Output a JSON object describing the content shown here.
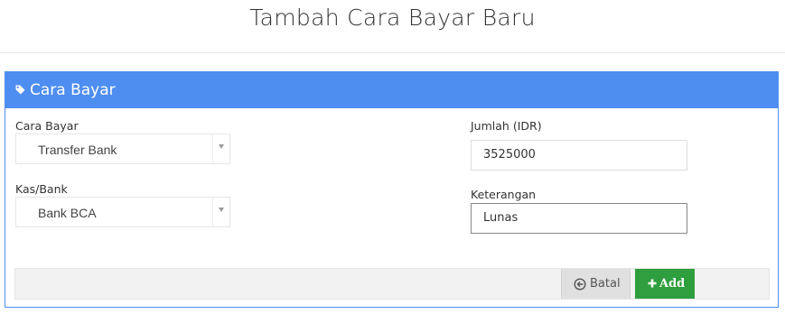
{
  "page": {
    "title": "Tambah Cara Bayar Baru"
  },
  "panel": {
    "heading": "Cara Bayar",
    "icon": "tag-icon",
    "accent_color": "#4f8ef1"
  },
  "form": {
    "cara_bayar": {
      "label": "Cara Bayar",
      "value": "Transfer Bank"
    },
    "kas_bank": {
      "label": "Kas/Bank",
      "value": "Bank BCA"
    },
    "jumlah": {
      "label": "Jumlah (IDR)",
      "value": "3525000"
    },
    "keterangan": {
      "label": "Keterangan",
      "value": "Lunas"
    }
  },
  "actions": {
    "cancel_label": "Batal",
    "cancel_icon": "circle-arrow-left-icon",
    "add_label": "Add",
    "add_icon": "plus-icon",
    "add_color": "#2e9e3e"
  }
}
